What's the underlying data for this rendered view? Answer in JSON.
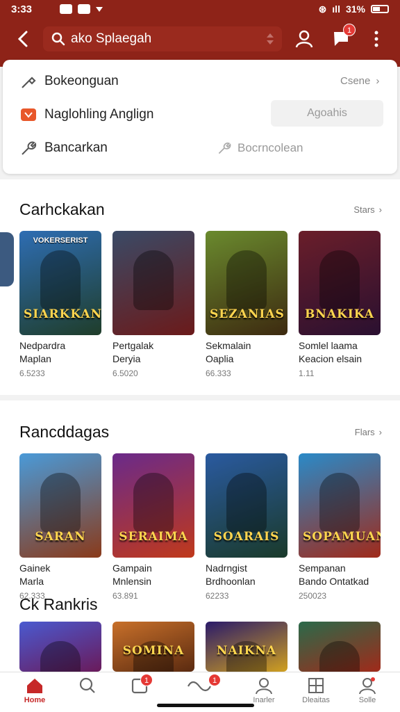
{
  "status": {
    "time": "3:33",
    "battery": "31%"
  },
  "search": {
    "value": "ako Splaegah"
  },
  "notifications": {
    "count": "1"
  },
  "menu": {
    "row1": {
      "label": "Bokeonguan",
      "right": "Csene"
    },
    "row2": {
      "label": "Naglohling Anglign",
      "right": "Agoahis"
    },
    "row3": {
      "label": "Bancarkan",
      "right": "Bocrncolean"
    }
  },
  "sections": [
    {
      "title": "Carhckakan",
      "more": "Stars",
      "items": [
        {
          "top_text": "VOKERSERIST",
          "logo": "SIARKKAN",
          "name1": "Nedpardra",
          "name2": "Maplan",
          "price": "6.5233",
          "colors": [
            "#2e6db3",
            "#1f3d2a"
          ]
        },
        {
          "top_text": "",
          "logo": "",
          "name1": "Pertgalak",
          "name2": "Deryia",
          "price": "6.5020",
          "colors": [
            "#3a4a66",
            "#6b1a1a"
          ]
        },
        {
          "top_text": "",
          "logo": "SEZANIAS",
          "name1": "Sekmalain",
          "name2": "Oaplia",
          "price": "66.333",
          "colors": [
            "#6a8a2e",
            "#3d2a10"
          ]
        },
        {
          "top_text": "",
          "logo": "BNAKIKA",
          "name1": "Somlel laama",
          "name2": "Keacion elsain",
          "price": "1.11",
          "colors": [
            "#6a1e2a",
            "#2a1030"
          ]
        }
      ]
    },
    {
      "title": "Rancddagas",
      "more": "Flars",
      "items": [
        {
          "top_text": "",
          "logo": "SARAN",
          "name1": "Gainek",
          "name2": "Marla",
          "price": "62.333",
          "colors": [
            "#4a9ad8",
            "#8a3a1a"
          ]
        },
        {
          "top_text": "",
          "logo": "SERAIMA",
          "name1": "Gampain",
          "name2": "Mnlensin",
          "price": "63.891",
          "colors": [
            "#6a2a8a",
            "#c0391b"
          ]
        },
        {
          "top_text": "",
          "logo": "SOARAIS",
          "name1": "Nadrngist",
          "name2": "Brdhoonlan",
          "price": "62233",
          "colors": [
            "#2a5aa0",
            "#1a3a2a"
          ]
        },
        {
          "top_text": "",
          "logo": "SOPAMUAN",
          "name1": "Sempanan",
          "name2": "Bando Ontatkad",
          "price": "250023",
          "colors": [
            "#2a8ac8",
            "#a02a1a"
          ]
        }
      ]
    },
    {
      "title": "Ck Rankris",
      "items": [
        {
          "logo": "",
          "colors": [
            "#4a5ad0",
            "#6a1a5a"
          ]
        },
        {
          "logo": "SOMINA",
          "colors": [
            "#c8702a",
            "#5a2a10"
          ]
        },
        {
          "logo": "NAIKNA",
          "colors": [
            "#2a1a6a",
            "#d0a020"
          ]
        },
        {
          "logo": "",
          "colors": [
            "#2a6a4a",
            "#a02a1a"
          ]
        }
      ]
    }
  ],
  "nav": [
    {
      "label": "Home",
      "icon": "home-icon"
    },
    {
      "label": "",
      "icon": "search-icon"
    },
    {
      "label": "",
      "icon": "inbox-icon",
      "badge": "1"
    },
    {
      "label": "",
      "icon": "gamepad-icon",
      "badge": "1"
    },
    {
      "label": "Inarler",
      "icon": "user-icon"
    },
    {
      "label": "Dleaitas",
      "icon": "grid-icon"
    },
    {
      "label": "Solle",
      "icon": "profile-icon"
    }
  ]
}
